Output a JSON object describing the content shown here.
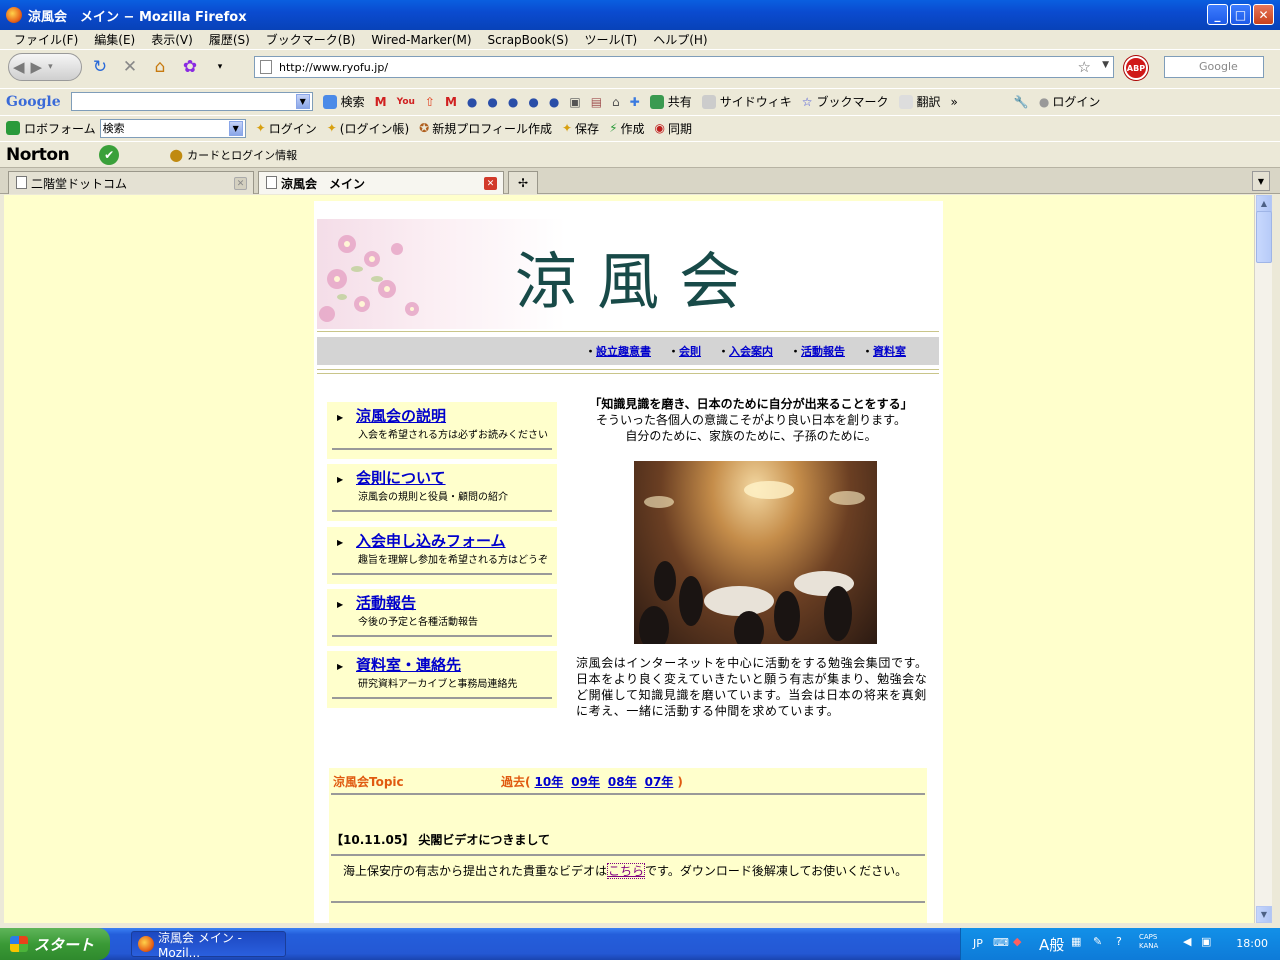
{
  "window": {
    "title": "涼風会　メイン − Mozilla Firefox"
  },
  "menubar": [
    "ファイル(F)",
    "編集(E)",
    "表示(V)",
    "履歴(S)",
    "ブックマーク(B)",
    "Wired-Marker(M)",
    "ScrapBook(S)",
    "ツール(T)",
    "ヘルプ(H)"
  ],
  "navbar": {
    "url": "http://www.ryofu.jp/",
    "search_placeholder": "Google",
    "abp": "ABP"
  },
  "google_toolbar": {
    "logo": "Google",
    "search_label": "検索",
    "share": "共有",
    "sidewiki": "サイドウィキ",
    "bookmarks": "ブックマーク",
    "translate": "翻訳",
    "more": "»",
    "login": "ログイン"
  },
  "roboform_toolbar": {
    "brand": "ロボフォーム",
    "search_value": "検索",
    "login": "ログイン",
    "login_account": "(ログイン帳)",
    "new_profile": "新規プロフィール作成",
    "save": "保存",
    "create": "作成",
    "sync": "同期"
  },
  "norton_toolbar": {
    "brand": "Norton",
    "cards": "カードとログイン情報"
  },
  "tabs": [
    {
      "label": "二階堂ドットコム",
      "active": false
    },
    {
      "label": "涼風会　メイン",
      "active": true
    }
  ],
  "page": {
    "banner_title": "涼風会",
    "nav_links": [
      "設立趣意書",
      "会則",
      "入会案内",
      "活動報告",
      "資料室"
    ],
    "menu_items": [
      {
        "title": "涼風会の説明",
        "sub": "入会を希望される方は必ずお読みください"
      },
      {
        "title": "会則について",
        "sub": "涼風会の規則と役員・顧問の紹介"
      },
      {
        "title": "入会申し込みフォーム",
        "sub": "趣旨を理解し参加を希望される方はどうぞ"
      },
      {
        "title": "活動報告",
        "sub": "今後の予定と各種活動報告"
      },
      {
        "title": "資料室・連絡先",
        "sub": "研究資料アーカイブと事務局連絡先"
      }
    ],
    "intro_line1": "「知識見識を磨き、日本のために自分が出来ることをする」",
    "intro_line2": "そういった各個人の意識こそがより良い日本を創ります。",
    "intro_line3": "自分のために、家族のために、子孫のために。",
    "description": "涼風会はインターネットを中心に活動をする勉強会集団です。日本をより良く変えていきたいと願う有志が集まり、勉強会など開催して知識見識を磨いています。当会は日本の将来を真剣に考え、一緒に活動する仲間を求めています。",
    "topic": {
      "heading": "涼風会Topic",
      "past_label": "過去(",
      "past_close": ")",
      "years": [
        "10年",
        "09年",
        "08年",
        "07年"
      ],
      "title": "【10.11.05】 尖閣ビデオにつきまして",
      "body_before": "海上保安庁の有志から提出された貴重なビデオは",
      "body_link": "こちら",
      "body_after": "です。ダウンロード後解凍してお使いください。"
    }
  },
  "taskbar": {
    "start": "スタート",
    "item": "涼風会 メイン - Mozil...",
    "lang": "JP",
    "ime": "A般",
    "caps": "CAPS",
    "kana": "KANA",
    "clock": "18:00"
  }
}
